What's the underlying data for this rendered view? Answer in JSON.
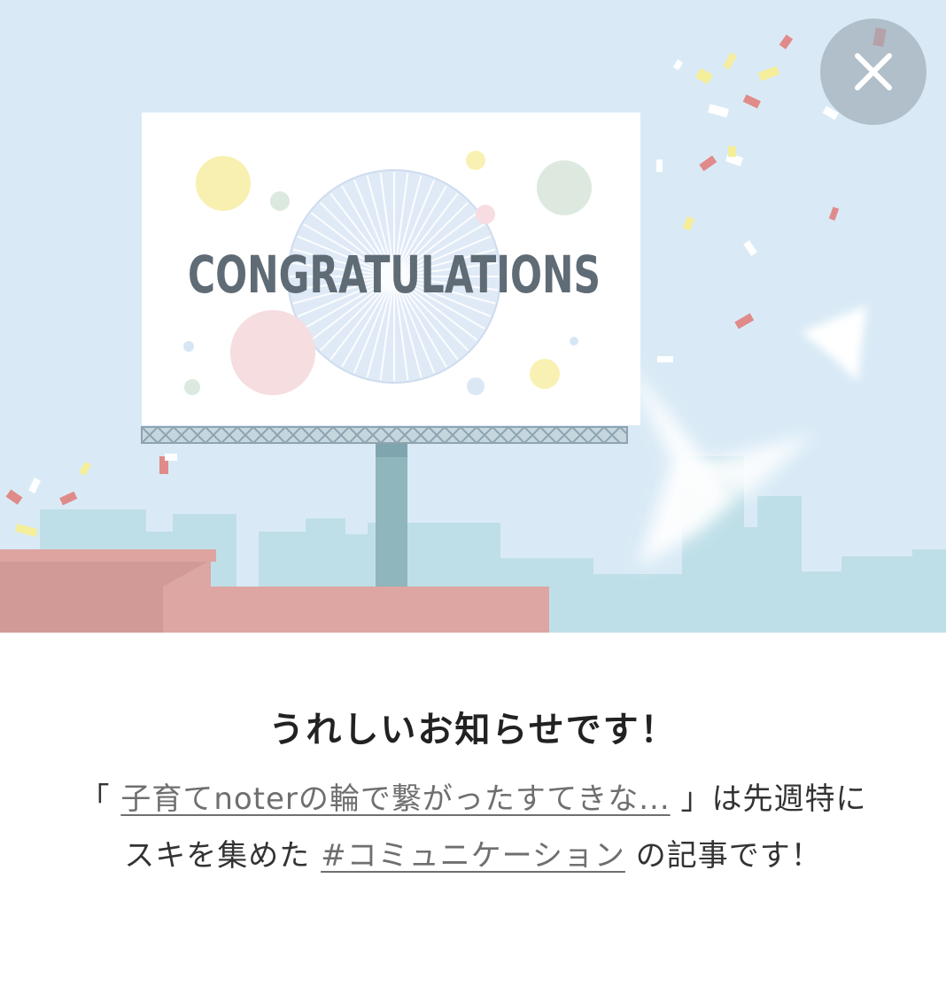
{
  "billboard": {
    "text": "CONGRATULATIONS"
  },
  "close_button": {
    "icon": "close-icon",
    "glyph": "✕"
  },
  "notice": {
    "headline": "うれしいお知らせです！",
    "quote_open": "「 ",
    "article_link": "子育てnoterの輪で繋がったすてきな...",
    "quote_close_and_text": " 」は先週",
    "text_middle": "特にスキを集めた ",
    "hashtag_link": "#コミュニケーション",
    "text_end": " の記事です！"
  },
  "colors": {
    "sky": "#d9eaf6",
    "city": "#bfdfe8",
    "roof": "#dea6a2",
    "billboard_text": "#5f6b75",
    "close_bg": "#a3b0b9"
  }
}
